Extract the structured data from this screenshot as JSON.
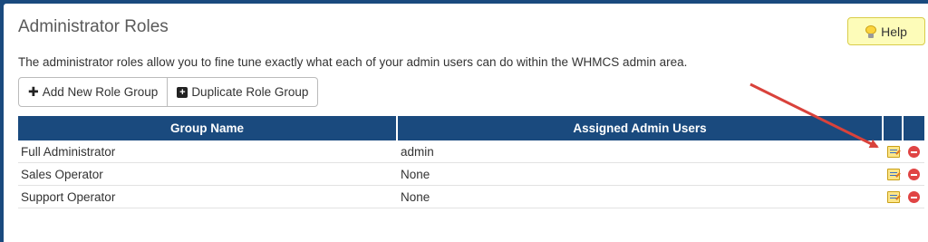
{
  "page": {
    "title": "Administrator Roles",
    "description": "The administrator roles allow you to fine tune exactly what each of your admin users can do within the WHMCS admin area."
  },
  "help_button": {
    "label": "Help",
    "icon": "lightbulb-icon"
  },
  "actions": {
    "add_label": "Add New Role Group",
    "duplicate_label": "Duplicate Role Group"
  },
  "table": {
    "headers": [
      "Group Name",
      "Assigned Admin Users"
    ],
    "rows": [
      {
        "group": "Full Administrator",
        "users": "admin"
      },
      {
        "group": "Sales Operator",
        "users": "None"
      },
      {
        "group": "Support Operator",
        "users": "None"
      }
    ]
  },
  "colors": {
    "header_bg": "#1a4a7e",
    "help_bg": "#fdfcb9",
    "annotation_arrow": "#d9423b"
  }
}
